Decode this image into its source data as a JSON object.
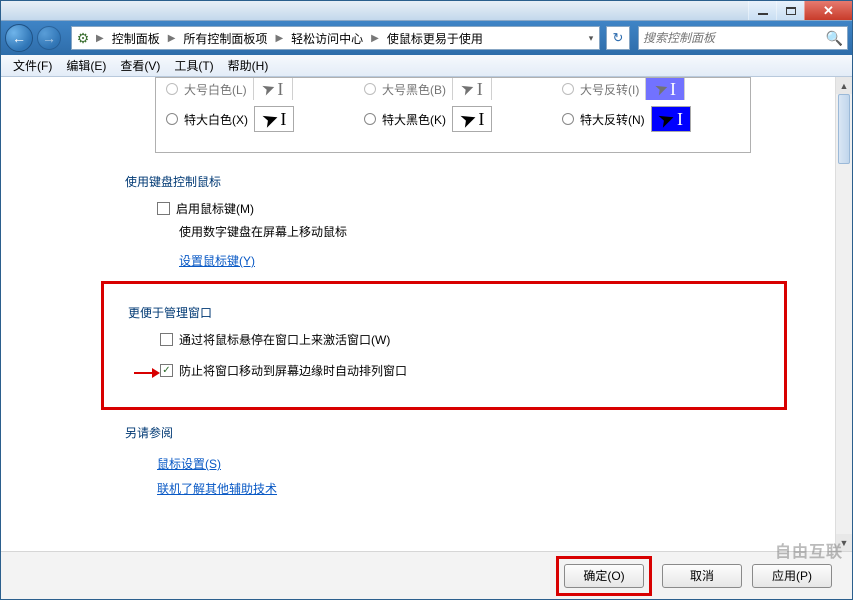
{
  "titlebar": {
    "close": "✕"
  },
  "nav": {
    "breadcrumb": [
      "控制面板",
      "所有控制面板项",
      "轻松访问中心",
      "使鼠标更易于使用"
    ],
    "search_placeholder": "搜索控制面板"
  },
  "menubar": [
    "文件(F)",
    "编辑(E)",
    "查看(V)",
    "工具(T)",
    "帮助(H)"
  ],
  "cursor_options": {
    "row1": [
      {
        "label": "大号白色(L)",
        "style": "white"
      },
      {
        "label": "大号黑色(B)",
        "style": "black"
      },
      {
        "label": "大号反转(I)",
        "style": "inverted"
      }
    ],
    "row2": [
      {
        "label": "特大白色(X)",
        "style": "white"
      },
      {
        "label": "特大黑色(K)",
        "style": "black"
      },
      {
        "label": "特大反转(N)",
        "style": "inverted"
      }
    ]
  },
  "sections": {
    "keyboard_control": {
      "heading": "使用键盘控制鼠标",
      "enable_mouse_keys": "启用鼠标键(M)",
      "description": "使用数字键盘在屏幕上移动鼠标",
      "setup_link": "设置鼠标键(Y)"
    },
    "window_mgmt": {
      "heading": "更便于管理窗口",
      "hover_activate": "通过将鼠标悬停在窗口上来激活窗口(W)",
      "prevent_arrange": "防止将窗口移动到屏幕边缘时自动排列窗口"
    },
    "see_also": {
      "heading": "另请参阅",
      "mouse_settings": "鼠标设置(S)",
      "other_assist": "联机了解其他辅助技术"
    }
  },
  "buttons": {
    "ok": "确定(O)",
    "cancel": "取消",
    "apply": "应用(P)"
  },
  "watermark": "自由互联"
}
